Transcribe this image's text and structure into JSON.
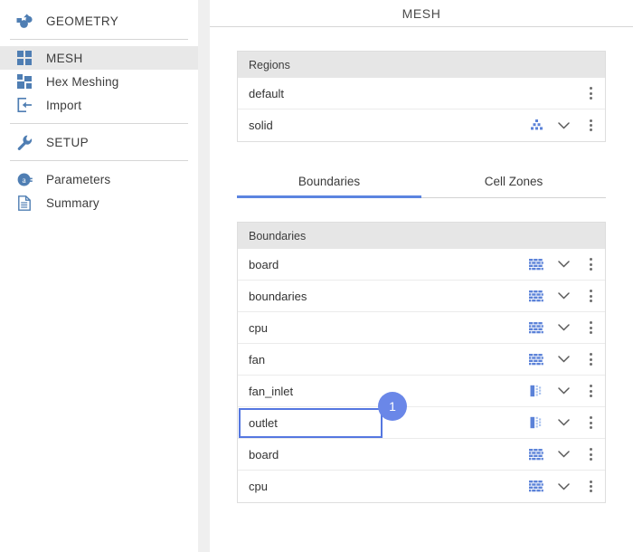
{
  "sidebar": {
    "groups": [
      {
        "items": [
          {
            "label": "GEOMETRY",
            "icon": "geometry-icon",
            "selected": false,
            "heading": true
          }
        ]
      },
      {
        "items": [
          {
            "label": "MESH",
            "icon": "mesh-grid-icon",
            "selected": true,
            "heading": false
          },
          {
            "label": "Hex Meshing",
            "icon": "hex-meshing-icon",
            "selected": false,
            "heading": false
          },
          {
            "label": "Import",
            "icon": "import-icon",
            "selected": false,
            "heading": false
          }
        ]
      },
      {
        "items": [
          {
            "label": "SETUP",
            "icon": "wrench-icon",
            "selected": false,
            "heading": true
          }
        ]
      },
      {
        "items": [
          {
            "label": "Parameters",
            "icon": "parameters-icon",
            "selected": false,
            "heading": false
          },
          {
            "label": "Summary",
            "icon": "summary-document-icon",
            "selected": false,
            "heading": false
          }
        ]
      }
    ]
  },
  "main": {
    "title": "MESH",
    "regions": {
      "header": "Regions",
      "rows": [
        {
          "label": "default",
          "type_icon": "",
          "has_chevron": false,
          "has_kebab": true
        },
        {
          "label": "solid",
          "type_icon": "solid-mesh-icon",
          "has_chevron": true,
          "has_kebab": true
        }
      ]
    },
    "tabs": [
      {
        "label": "Boundaries",
        "active": true
      },
      {
        "label": "Cell Zones",
        "active": false
      }
    ],
    "boundaries": {
      "header": "Boundaries",
      "rows": [
        {
          "label": "board",
          "type_icon": "wall-brick-icon",
          "has_chevron": true,
          "has_kebab": true,
          "focused": false,
          "badge": ""
        },
        {
          "label": "boundaries",
          "type_icon": "wall-brick-icon",
          "has_chevron": true,
          "has_kebab": true,
          "focused": false,
          "badge": ""
        },
        {
          "label": "cpu",
          "type_icon": "wall-brick-icon",
          "has_chevron": true,
          "has_kebab": true,
          "focused": false,
          "badge": ""
        },
        {
          "label": "fan",
          "type_icon": "wall-brick-icon",
          "has_chevron": true,
          "has_kebab": true,
          "focused": false,
          "badge": ""
        },
        {
          "label": "fan_inlet",
          "type_icon": "inlet-outlet-icon",
          "has_chevron": true,
          "has_kebab": true,
          "focused": false,
          "badge": ""
        },
        {
          "label": "outlet",
          "type_icon": "inlet-outlet-icon",
          "has_chevron": true,
          "has_kebab": true,
          "focused": true,
          "badge": "1"
        },
        {
          "label": "board",
          "type_icon": "wall-brick-icon",
          "has_chevron": true,
          "has_kebab": true,
          "focused": false,
          "badge": ""
        },
        {
          "label": "cpu",
          "type_icon": "wall-brick-icon",
          "has_chevron": true,
          "has_kebab": true,
          "focused": false,
          "badge": ""
        }
      ]
    }
  },
  "colors": {
    "accent_blue": "#5b84e0",
    "badge_blue": "#6a87e8",
    "icon_blue": "#5585c5",
    "type_icon_blue": "#5b82d8",
    "panel_bg": "#ffffff",
    "gap_bg": "#efefef",
    "header_row_bg": "#e6e6e6",
    "selected_nav_bg": "#e8e8e8"
  }
}
